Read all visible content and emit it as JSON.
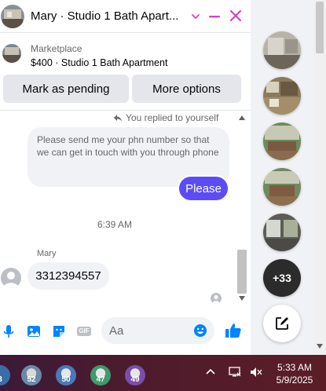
{
  "header": {
    "title": "Mary · Studio 1 Bath Apart...",
    "icons": [
      "chevron-down-icon",
      "minimize-icon",
      "close-icon"
    ],
    "accent_color": "#d63fd0"
  },
  "listing": {
    "category": "Marketplace",
    "item": "$400 · Studio 1 Bath Apartment"
  },
  "actions": {
    "pending_label": "Mark as pending",
    "more_label": "More options"
  },
  "conversation": {
    "replied_note": "You replied to yourself",
    "quoted_message": "Please send me your phn  number so that we can get in touch with you through phone",
    "sent_message": "Please",
    "sent_color": "#5b4cf5",
    "timestamp": "6:39 AM",
    "sender_name": "Mary",
    "received_message": "3312394557"
  },
  "composer": {
    "placeholder": "Aa",
    "icons": [
      "mic-icon",
      "photo-icon",
      "sticker-icon",
      "gif-icon",
      "emoji-icon",
      "like-icon"
    ],
    "gif_label": "GIF",
    "icon_color": "#0084ff"
  },
  "chat_heads": {
    "more_count": "+33"
  },
  "taskbar": {
    "badges": [
      "3",
      "52",
      "50",
      "47",
      "49"
    ],
    "time": "5:33 AM",
    "date": "5/9/2025"
  }
}
